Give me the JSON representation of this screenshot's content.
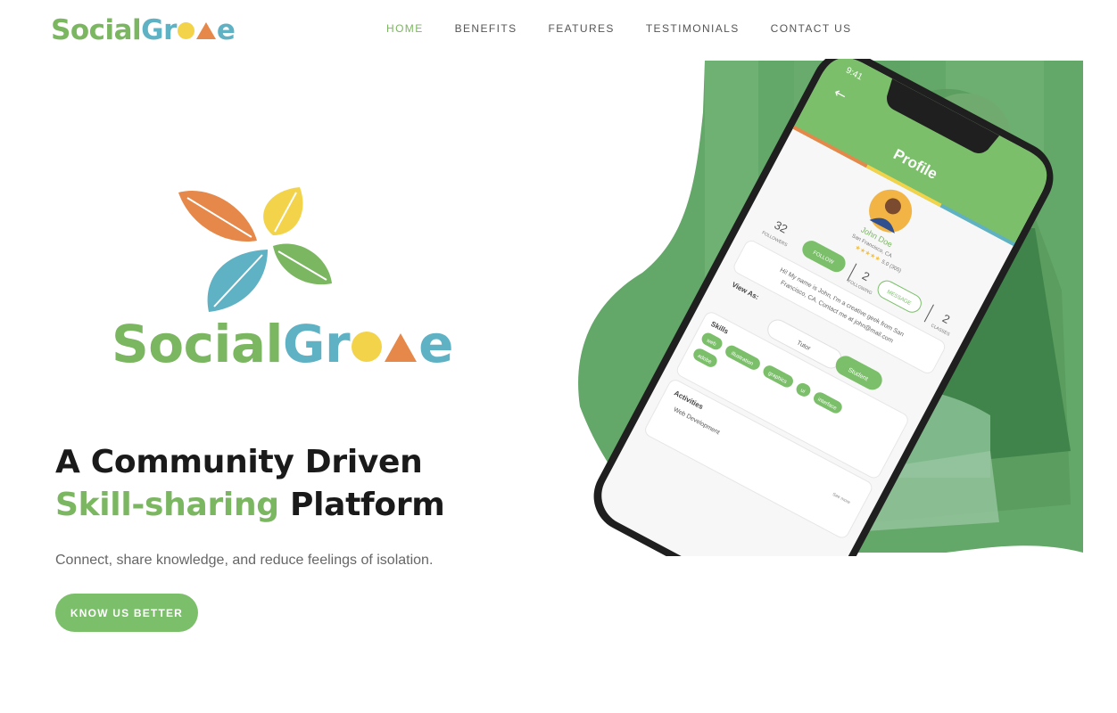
{
  "brand": {
    "part1": "Social",
    "part2": "Gr",
    "part3": "e",
    "colors": {
      "green": "#7bb661",
      "teal": "#5fb1c4",
      "yellow": "#f2d34a",
      "orange": "#e6884a"
    }
  },
  "nav": {
    "items": [
      {
        "label": "HOME",
        "active": true
      },
      {
        "label": "BENEFITS"
      },
      {
        "label": "FEATURES"
      },
      {
        "label": "TESTIMONIALS"
      },
      {
        "label": "CONTACT US"
      }
    ]
  },
  "hero": {
    "headline_line1": "A Community Driven",
    "headline_green": "Skill-sharing",
    "headline_rest": "Platform",
    "subtitle": "Connect, share knowledge, and reduce feelings of isolation.",
    "cta_label": "KNOW US BETTER"
  },
  "phone": {
    "time": "9:41",
    "screen_title": "Profile",
    "user_name": "John Doe",
    "user_location": "San Francisco, CA",
    "rating": "5.0 (305)",
    "follow_label": "FOLLOW",
    "message_label": "MESSAGE",
    "stats": [
      {
        "value": "32",
        "label": "FOLLOWERS"
      },
      {
        "value": "2",
        "label": "FOLLOWING"
      },
      {
        "value": "2",
        "label": "CLASSES"
      }
    ],
    "bio_line1": "Hi! My name is John, I'm a creative geek from San",
    "bio_line2": "Francisco, CA. Contact me at john@mail.com",
    "view_as_label": "View As:",
    "tutor_label": "Tutor",
    "student_label": "Student",
    "skills_label": "Skills",
    "skills": [
      "web",
      "illustration",
      "graphics",
      "ui",
      "interface",
      "adobe"
    ],
    "activities_label": "Activities",
    "activity_item": "Web Development",
    "see_more": "See more"
  }
}
